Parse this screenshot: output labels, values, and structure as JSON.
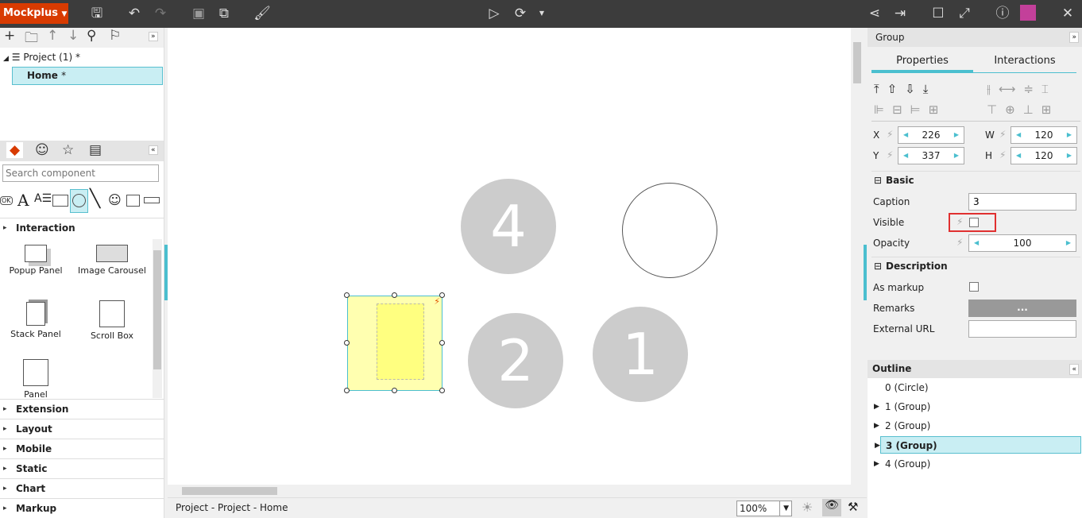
{
  "app": {
    "logo": "Mockplus",
    "logo_arrow": "▼"
  },
  "toolbar": {
    "icons": [
      "save-icon",
      "undo-icon",
      "redo-icon",
      "group-icon",
      "ungroup-icon",
      "format-brush-icon",
      "play-icon",
      "refresh-icon",
      "share-icon",
      "export-icon",
      "window-icon",
      "fullscreen-icon",
      "help-icon",
      "avatar",
      "close-icon"
    ]
  },
  "project_tree": {
    "root": "Project (1)",
    "root_mark": "*",
    "page": "Home",
    "page_mark": "*"
  },
  "components": {
    "search_placeholder": "Search component",
    "ok_label": "OK",
    "sections": [
      {
        "label": "Interaction",
        "expanded": true
      },
      {
        "label": "Extension"
      },
      {
        "label": "Layout"
      },
      {
        "label": "Mobile"
      },
      {
        "label": "Static"
      },
      {
        "label": "Chart"
      },
      {
        "label": "Markup"
      }
    ],
    "items": [
      "Popup Panel",
      "Image Carousel",
      "Stack Panel",
      "Scroll Box",
      "Panel"
    ]
  },
  "canvas": {
    "circles": [
      "4",
      "",
      "2",
      "1"
    ],
    "accent": "#4bbfcf"
  },
  "status": {
    "breadcrumb": "Project - Project - Home",
    "zoom": "100%"
  },
  "props": {
    "title": "Group",
    "tabs": [
      "Properties",
      "Interactions"
    ],
    "active_tab": "Properties",
    "x_label": "X",
    "x": "226",
    "y_label": "Y",
    "y": "337",
    "w_label": "W",
    "w": "120",
    "h_label": "H",
    "h": "120",
    "basic": "Basic",
    "caption_label": "Caption",
    "caption": "3",
    "visible_label": "Visible",
    "visible": false,
    "opacity_label": "Opacity",
    "opacity": "100",
    "description": "Description",
    "markup_label": "As markup",
    "remarks_label": "Remarks",
    "remarks_btn": "...",
    "url_label": "External URL",
    "url": ""
  },
  "outline": {
    "title": "Outline",
    "items": [
      "0 (Circle)",
      "1 (Group)",
      "2 (Group)",
      "3 (Group)",
      "4 (Group)"
    ],
    "selected": "3 (Group)"
  }
}
